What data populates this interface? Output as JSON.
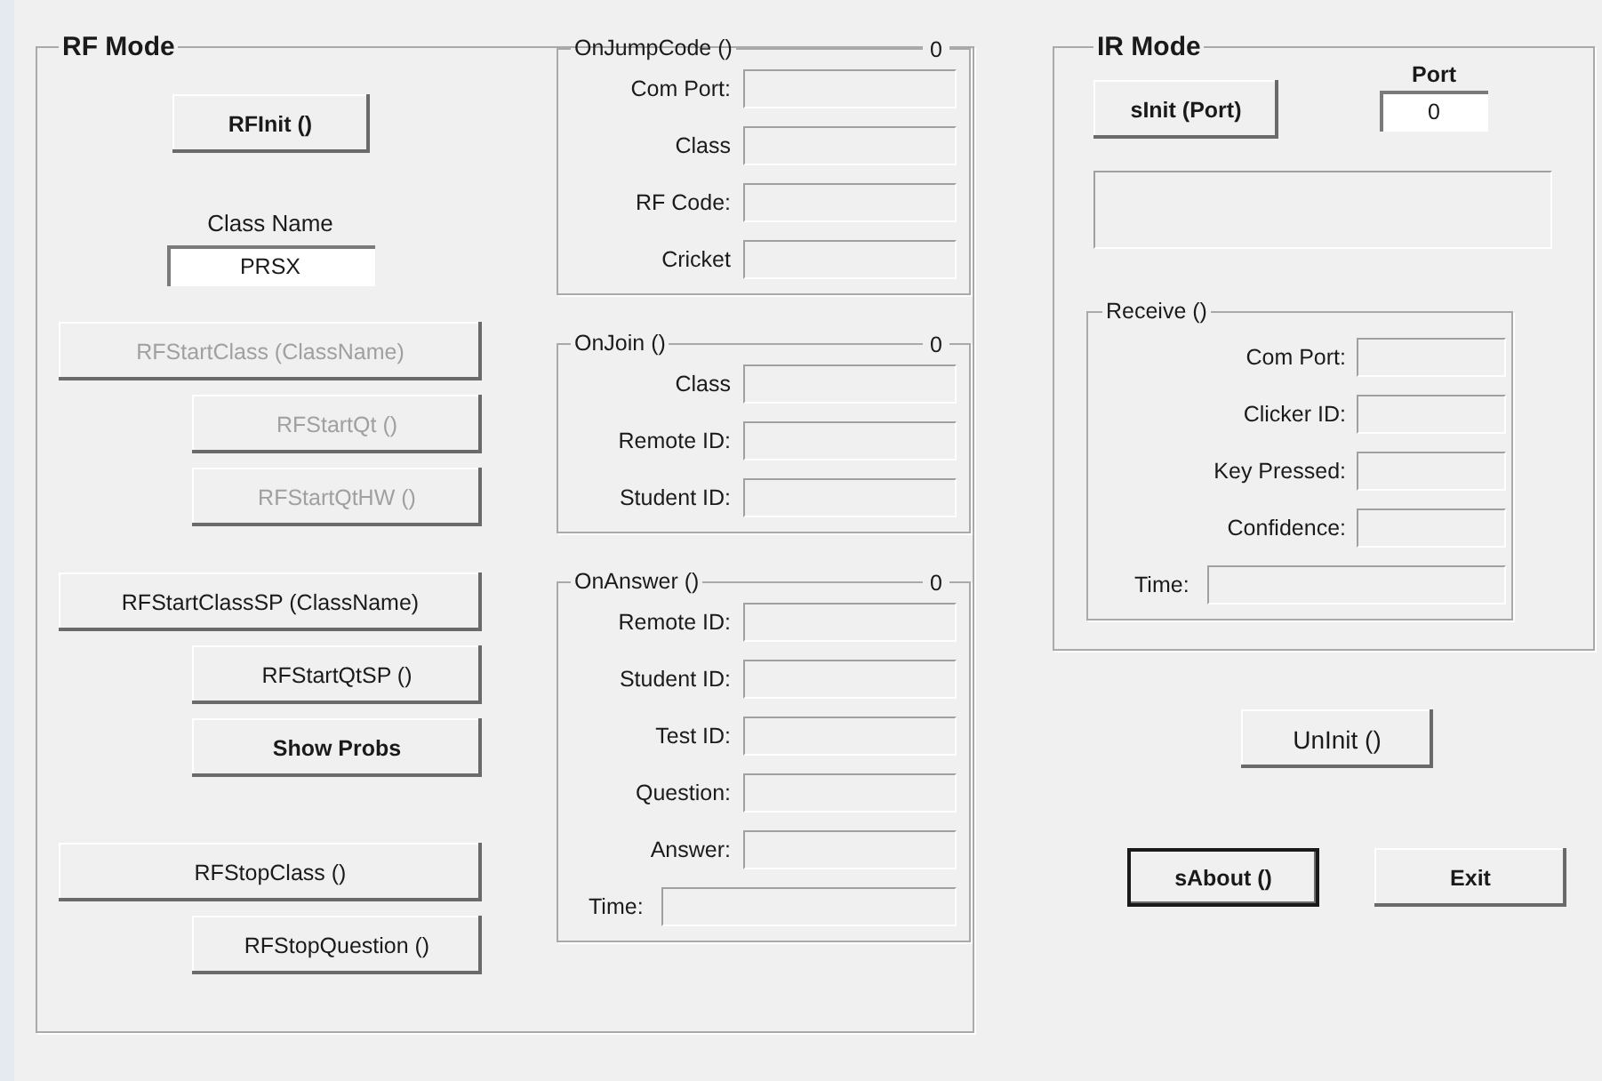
{
  "rf_mode": {
    "title": "RF Mode",
    "groups": [
      [
        {
          "kind": "button",
          "label": "RFInit ()",
          "bold": true,
          "disabled": false,
          "indented": false
        }
      ],
      [
        {
          "kind": "field",
          "label": "Class Name",
          "value": "PRSX"
        }
      ],
      [
        {
          "kind": "button",
          "label": "RFStartClass (ClassName)",
          "bold": false,
          "disabled": true,
          "indented": false
        },
        {
          "kind": "button",
          "label": "RFStartQt ()",
          "bold": false,
          "disabled": true,
          "indented": true
        },
        {
          "kind": "button",
          "label": "RFStartQtHW ()",
          "bold": false,
          "disabled": true,
          "indented": true
        }
      ],
      [
        {
          "kind": "button",
          "label": "RFStartClassSP (ClassName)",
          "bold": false,
          "disabled": false,
          "indented": false
        },
        {
          "kind": "button",
          "label": "RFStartQtSP ()",
          "bold": false,
          "disabled": false,
          "indented": true
        },
        {
          "kind": "button",
          "label": "Show Probs",
          "bold": true,
          "disabled": false,
          "indented": true
        }
      ],
      [
        {
          "kind": "button",
          "label": "RFStopClass ()",
          "bold": false,
          "disabled": false,
          "indented": false
        },
        {
          "kind": "button",
          "label": "RFStopQuestion ()",
          "bold": false,
          "disabled": false,
          "indented": true
        }
      ]
    ],
    "events": [
      {
        "title": "OnJumpCode ()",
        "count": "0",
        "rows": [
          {
            "kind": "field",
            "label": "Com Port:"
          },
          {
            "kind": "field",
            "label": "Class"
          },
          {
            "kind": "field",
            "label": "RF Code:"
          },
          {
            "kind": "field",
            "label": "Cricket"
          }
        ]
      },
      {
        "title": "OnJoin ()",
        "count": "0",
        "rows": [
          {
            "kind": "field",
            "label": "Class"
          },
          {
            "kind": "field",
            "label": "Remote ID:"
          },
          {
            "kind": "field",
            "label": "Student ID:"
          }
        ]
      },
      {
        "title": "OnAnswer ()",
        "count": "0",
        "rows": [
          {
            "kind": "field",
            "label": "Remote ID:"
          },
          {
            "kind": "field",
            "label": "Student ID:"
          },
          {
            "kind": "field",
            "label": "Test ID:"
          },
          {
            "kind": "field",
            "label": "Question:"
          },
          {
            "kind": "field",
            "label": "Answer:"
          },
          {
            "kind": "wide",
            "label": "Time:"
          }
        ]
      }
    ]
  },
  "ir_mode": {
    "title": "IR Mode",
    "init_button": "sInit (Port)",
    "port": {
      "label": "Port",
      "value": "0"
    },
    "receive": {
      "title": "Receive ()",
      "rows": [
        {
          "kind": "field",
          "label": "Com Port:"
        },
        {
          "kind": "field",
          "label": "Clicker ID:"
        },
        {
          "kind": "field",
          "label": "Key Pressed:"
        },
        {
          "kind": "field",
          "label": "Confidence:"
        },
        {
          "kind": "wide",
          "label": "Time:"
        }
      ]
    }
  },
  "uninit_button": "UnInit ()",
  "bottom_buttons": [
    {
      "label": "sAbout ()",
      "default": true
    },
    {
      "label": "Exit",
      "default": false
    }
  ]
}
